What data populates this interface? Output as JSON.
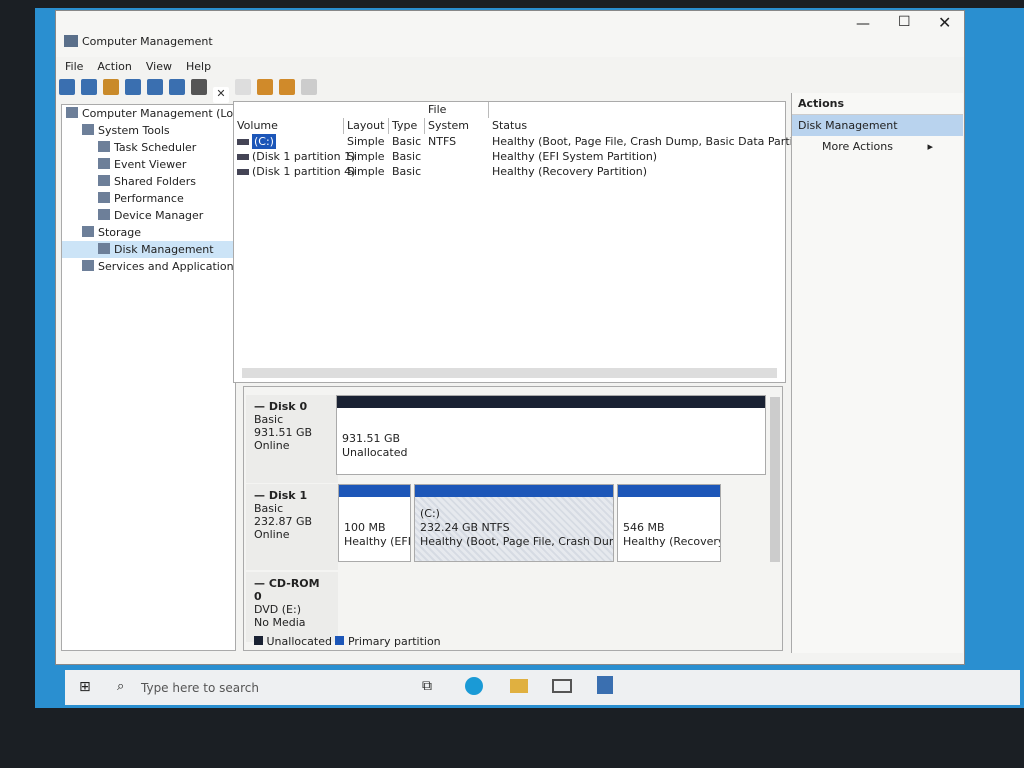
{
  "window": {
    "title": "Computer Management"
  },
  "menu": [
    "File",
    "Action",
    "View",
    "Help"
  ],
  "tree": [
    {
      "label": "Computer Management (Loca",
      "indent": 0
    },
    {
      "label": "System Tools",
      "indent": 1
    },
    {
      "label": "Task Scheduler",
      "indent": 2
    },
    {
      "label": "Event Viewer",
      "indent": 2
    },
    {
      "label": "Shared Folders",
      "indent": 2
    },
    {
      "label": "Performance",
      "indent": 2
    },
    {
      "label": "Device Manager",
      "indent": 2
    },
    {
      "label": "Storage",
      "indent": 1
    },
    {
      "label": "Disk Management",
      "indent": 2,
      "selected": true
    },
    {
      "label": "Services and Applications",
      "indent": 1
    }
  ],
  "volumes": {
    "headers": [
      "Volume",
      "Layout",
      "Type",
      "File System",
      "Status"
    ],
    "rows": [
      [
        "(C:)",
        "Simple",
        "Basic",
        "NTFS",
        "Healthy (Boot, Page File, Crash Dump, Basic Data Partition)"
      ],
      [
        "(Disk 1 partition 1)",
        "Simple",
        "Basic",
        "",
        "Healthy (EFI System Partition)"
      ],
      [
        "(Disk 1 partition 4)",
        "Simple",
        "Basic",
        "",
        "Healthy (Recovery Partition)"
      ]
    ]
  },
  "disks": [
    {
      "name": "Disk 0",
      "type": "Basic",
      "size": "931.51 GB",
      "state": "Online",
      "parts": [
        {
          "line1": "",
          "line2": "931.51 GB",
          "line3": "Unallocated"
        }
      ]
    },
    {
      "name": "Disk 1",
      "type": "Basic",
      "size": "232.87 GB",
      "state": "Online",
      "parts": [
        {
          "line1": "",
          "line2": "100 MB",
          "line3": "Healthy (EFI"
        },
        {
          "line1": "(C:)",
          "line2": "232.24 GB NTFS",
          "line3": "Healthy (Boot, Page File, Crash Dump, E"
        },
        {
          "line1": "",
          "line2": "546 MB",
          "line3": "Healthy (Recovery"
        }
      ]
    },
    {
      "name": "CD-ROM 0",
      "type": "DVD (E:)",
      "size": "",
      "state": "No Media",
      "parts": []
    }
  ],
  "legend": {
    "unallocated": "Unallocated",
    "primary": "Primary partition",
    "colors": {
      "unallocated": "#1a2233",
      "primary": "#1c56b8"
    }
  },
  "actions": {
    "title": "Actions",
    "section": "Disk Management",
    "more": "More Actions"
  },
  "taskbar": {
    "search_placeholder": "Type here to search"
  }
}
